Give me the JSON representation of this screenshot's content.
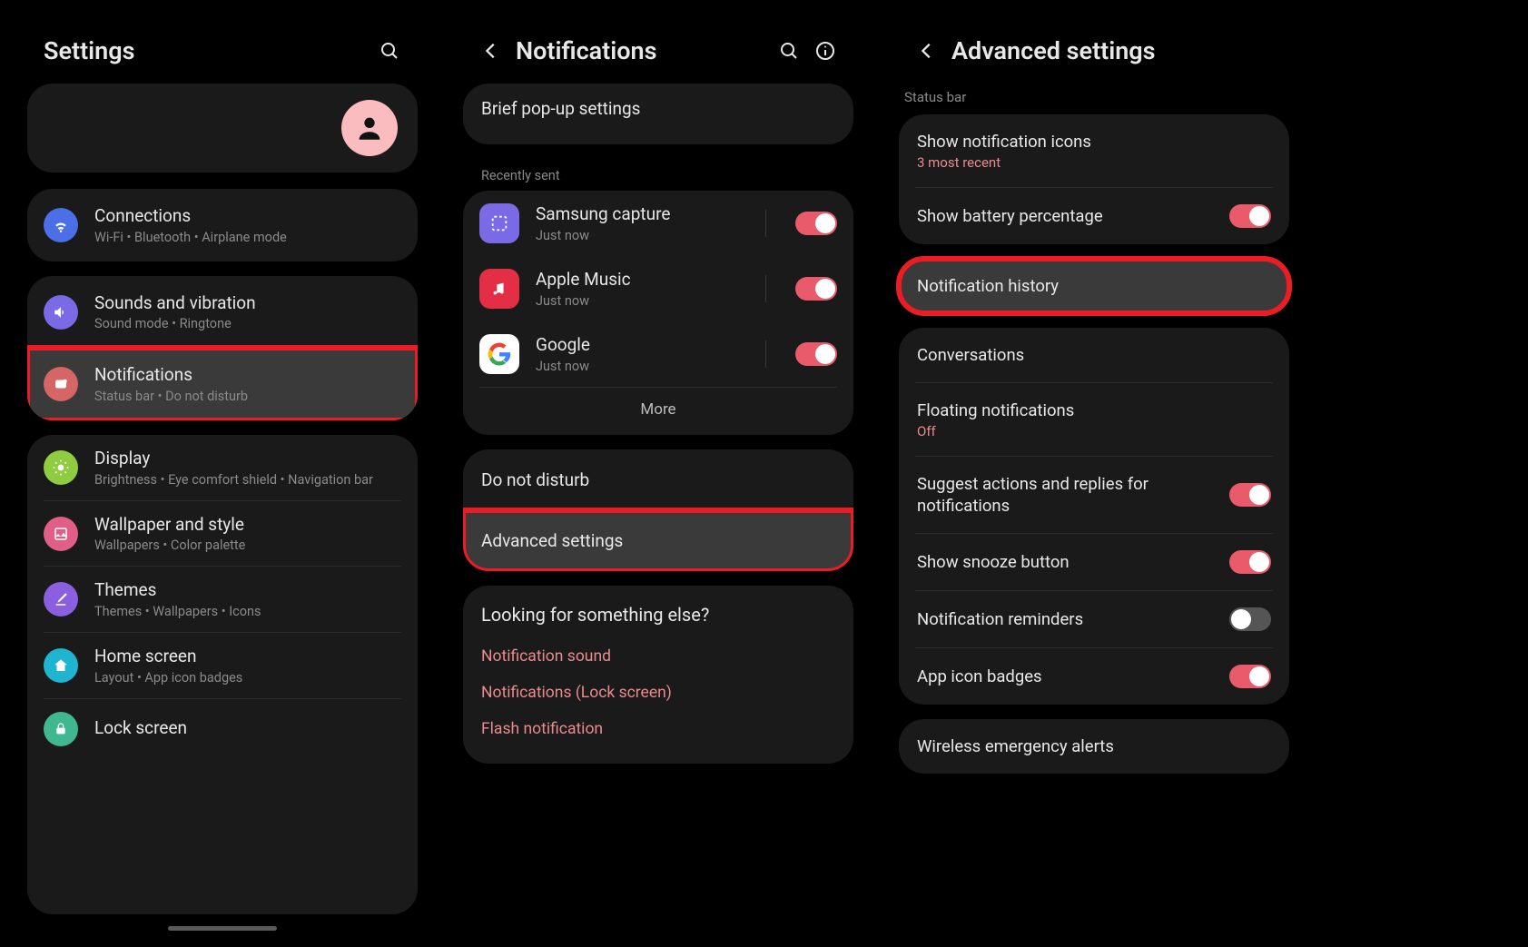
{
  "screen1": {
    "title": "Settings",
    "items": {
      "connections": {
        "title": "Connections",
        "sub": "Wi-Fi  •  Bluetooth  •  Airplane mode"
      },
      "sounds": {
        "title": "Sounds and vibration",
        "sub": "Sound mode  •  Ringtone"
      },
      "notifications": {
        "title": "Notifications",
        "sub": "Status bar  •  Do not disturb"
      },
      "display": {
        "title": "Display",
        "sub": "Brightness  •  Eye comfort shield  •  Navigation bar"
      },
      "wallpaper": {
        "title": "Wallpaper and style",
        "sub": "Wallpapers  •  Color palette"
      },
      "themes": {
        "title": "Themes",
        "sub": "Themes  •  Wallpapers  •  Icons"
      },
      "home": {
        "title": "Home screen",
        "sub": "Layout  •  App icon badges"
      },
      "lock": {
        "title": "Lock screen"
      }
    }
  },
  "screen2": {
    "title": "Notifications",
    "brief": "Brief pop-up settings",
    "recently_label": "Recently sent",
    "recent": [
      {
        "title": "Samsung capture",
        "sub": "Just now"
      },
      {
        "title": "Apple Music",
        "sub": "Just now"
      },
      {
        "title": "Google",
        "sub": "Just now"
      }
    ],
    "more": "More",
    "dnd": "Do not disturb",
    "advanced": "Advanced settings",
    "looking": "Looking for something else?",
    "links": [
      "Notification sound",
      "Notifications (Lock screen)",
      "Flash notification"
    ]
  },
  "screen3": {
    "title": "Advanced settings",
    "statusbar_label": "Status bar",
    "show_icons": {
      "title": "Show notification icons",
      "sub": "3 most recent"
    },
    "battery": "Show battery percentage",
    "history": "Notification history",
    "conversations": "Conversations",
    "floating": {
      "title": "Floating notifications",
      "sub": "Off"
    },
    "suggest": "Suggest actions and replies for notifications",
    "snooze": "Show snooze button",
    "reminders": "Notification reminders",
    "badges": "App icon badges",
    "wireless": "Wireless emergency alerts"
  }
}
